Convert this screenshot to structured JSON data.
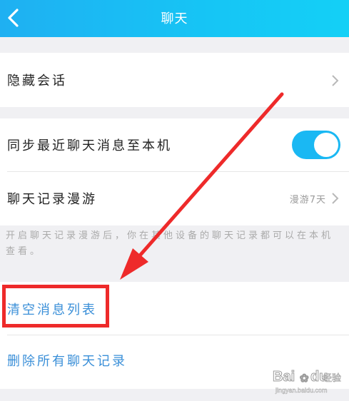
{
  "header": {
    "title": "聊天"
  },
  "sections": {
    "hidden": {
      "label": "隐藏会话"
    },
    "sync": {
      "label": "同步最近聊天消息至本机",
      "enabled": true
    },
    "roaming": {
      "label": "聊天记录漫游",
      "value": "漫游7天"
    },
    "hint": "开启聊天记录漫游后，你在其他设备的聊天记录都可以在本机查看。",
    "clear": {
      "label": "清空消息列表"
    },
    "delete": {
      "label": "删除所有聊天记录"
    }
  },
  "watermark": {
    "text": "Bai du 经验",
    "url": "jingyan.baidu.com"
  },
  "colors": {
    "header": "#1fb0f2",
    "toggle": "#1ab8f3",
    "link": "#3a8fd8",
    "annotation": "#ee2a2a"
  }
}
